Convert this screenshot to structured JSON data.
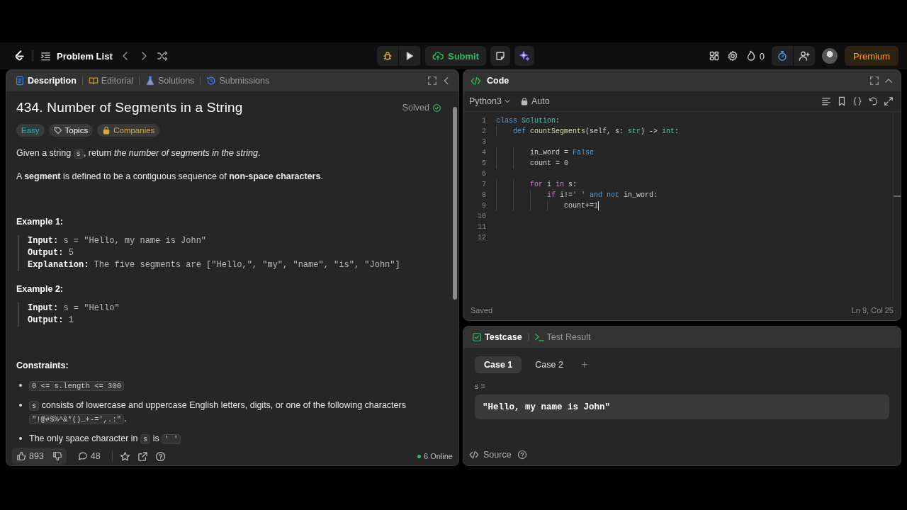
{
  "nav": {
    "problem_list": "Problem List",
    "submit": "Submit",
    "streak": "0",
    "premium": "Premium"
  },
  "description_panel": {
    "tabs": [
      {
        "label": "Description",
        "kind": "description",
        "selected": true
      },
      {
        "label": "Editorial",
        "kind": "editorial",
        "selected": false
      },
      {
        "label": "Solutions",
        "kind": "solutions",
        "selected": false
      },
      {
        "label": "Submissions",
        "kind": "submissions",
        "selected": false
      }
    ],
    "title": "434. Number of Segments in a String",
    "status": "Solved",
    "tags": [
      {
        "label": "Easy",
        "kind": "difficulty"
      },
      {
        "label": "Topics",
        "kind": "topics"
      },
      {
        "label": "Companies",
        "kind": "companies"
      }
    ],
    "paragraphs": [
      [
        {
          "kind": "text",
          "text": "Given a string "
        },
        {
          "kind": "code",
          "text": "s"
        },
        {
          "kind": "text",
          "text": ", return *the number of segments in the string*."
        }
      ],
      [
        {
          "kind": "text",
          "text": "A **segment** is defined to be a contiguous sequence of **non-space characters**."
        }
      ]
    ],
    "examples": [
      {
        "heading": "Example 1:",
        "lines": [
          {
            "label": "Input:",
            "value": "s = \"Hello, my name is John\""
          },
          {
            "label": "Output:",
            "value": "5"
          },
          {
            "label": "Explanation:",
            "value": "The five segments are [\"Hello,\", \"my\", \"name\", \"is\", \"John\"]"
          }
        ]
      },
      {
        "heading": "Example 2:",
        "lines": [
          {
            "label": "Input:",
            "value": "s = \"Hello\""
          },
          {
            "label": "Output:",
            "value": "1"
          }
        ]
      }
    ],
    "constraints_heading": "Constraints:",
    "constraints": [
      [
        {
          "kind": "code",
          "text": "0 <= s.length <= 300"
        }
      ],
      [
        {
          "kind": "code",
          "text": "s"
        },
        {
          "kind": "text",
          "text": " consists of lowercase and uppercase English letters, digits, or one of the following characters "
        },
        {
          "kind": "code",
          "text": "\"!@#$%^&*()_+-=',.:\""
        },
        {
          "kind": "text",
          "text": "."
        }
      ],
      [
        {
          "kind": "text",
          "text": "The only space character in "
        },
        {
          "kind": "code",
          "text": "s"
        },
        {
          "kind": "text",
          "text": " is "
        },
        {
          "kind": "code",
          "text": "' '"
        }
      ]
    ],
    "footer": {
      "likes": "893",
      "comments": "48",
      "online": "6 Online"
    }
  },
  "code_panel": {
    "title": "Code",
    "language": "Python3",
    "mode": "Auto",
    "status": "Saved",
    "position": "Ln 9, Col 25",
    "lines": [
      {
        "number": "1",
        "cursor": false,
        "tokens": [
          {
            "kind": "keyword",
            "text": "class"
          },
          {
            "kind": "type",
            "text": " Solution"
          },
          {
            "kind": "plain",
            "text": ":"
          }
        ]
      },
      {
        "number": "2",
        "cursor": false,
        "tokens": [
          {
            "kind": "keyword",
            "text": "    def"
          },
          {
            "kind": "function",
            "text": " countSegments"
          },
          {
            "kind": "plain",
            "text": "(self, s: "
          },
          {
            "kind": "type",
            "text": "str"
          },
          {
            "kind": "plain",
            "text": ") -> "
          },
          {
            "kind": "type",
            "text": "int"
          },
          {
            "kind": "plain",
            "text": ":"
          }
        ]
      },
      {
        "number": "3",
        "cursor": false
      },
      {
        "number": "4",
        "cursor": false,
        "tokens": [
          {
            "kind": "plain",
            "text": "        in_word = "
          },
          {
            "kind": "keyword",
            "text": "False"
          }
        ]
      },
      {
        "number": "5",
        "cursor": false,
        "tokens": [
          {
            "kind": "plain",
            "text": "        count = "
          },
          {
            "kind": "number",
            "text": "0"
          }
        ]
      },
      {
        "number": "6",
        "cursor": false
      },
      {
        "number": "7",
        "cursor": false,
        "tokens": [
          {
            "kind": "control",
            "text": "        for"
          },
          {
            "kind": "plain",
            "text": " i "
          },
          {
            "kind": "control",
            "text": "in"
          },
          {
            "kind": "plain",
            "text": " s:"
          }
        ]
      },
      {
        "number": "8",
        "cursor": false,
        "tokens": [
          {
            "kind": "control",
            "text": "            if"
          },
          {
            "kind": "plain",
            "text": " i!="
          },
          {
            "kind": "string",
            "text": "' '"
          },
          {
            "kind": "keyword",
            "text": " and"
          },
          {
            "kind": "keyword",
            "text": " not"
          },
          {
            "kind": "plain",
            "text": " in_word:"
          }
        ]
      },
      {
        "number": "9",
        "cursor": true,
        "tokens": [
          {
            "kind": "plain",
            "text": "                count+="
          },
          {
            "kind": "number",
            "text": "1"
          }
        ]
      },
      {
        "number": "10",
        "cursor": false
      },
      {
        "number": "11",
        "cursor": false
      },
      {
        "number": "12",
        "cursor": false
      }
    ]
  },
  "testcase_panel": {
    "tabs": [
      {
        "label": "Testcase",
        "kind": "testcase",
        "selected": true
      },
      {
        "label": "Test Result",
        "kind": "result",
        "selected": false
      }
    ],
    "cases": [
      {
        "label": "Case 1",
        "selected": true
      },
      {
        "label": "Case 2",
        "selected": false
      }
    ],
    "add": "+",
    "param_label": "s =",
    "param_value": "\"Hello, my name is John\"",
    "source": "Source"
  }
}
